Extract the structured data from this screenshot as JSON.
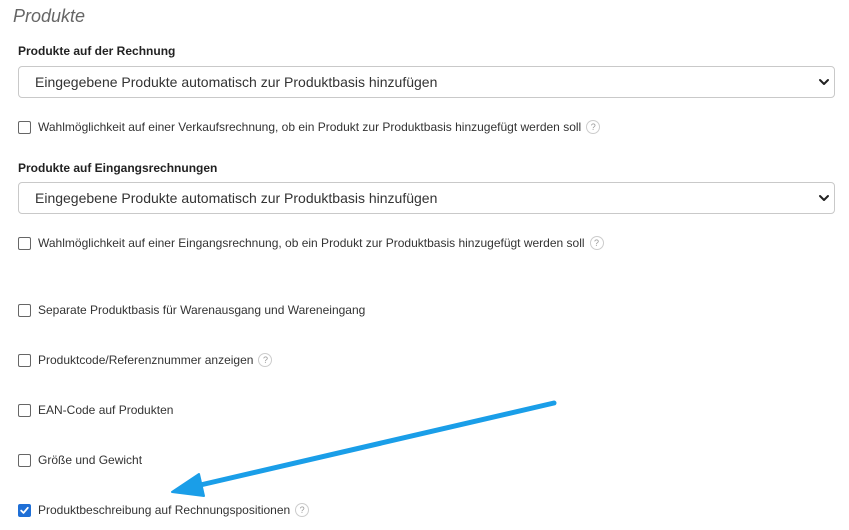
{
  "section": {
    "title": "Produkte"
  },
  "sales": {
    "label": "Produkte auf der Rechnung",
    "select_value": "Eingegebene Produkte automatisch zur Produktbasis hinzufügen",
    "checkbox_label": "Wahlmöglichkeit auf einer Verkaufsrechnung, ob ein Produkt zur Produktbasis hinzugefügt werden soll",
    "checked": false
  },
  "purchase": {
    "label": "Produkte auf Eingangsrechnungen",
    "select_value": "Eingegebene Produkte automatisch zur Produktbasis hinzufügen",
    "checkbox_label": "Wahlmöglichkeit auf einer Eingangsrechnung, ob ein Produkt zur Produktbasis hinzugefügt werden soll",
    "checked": false
  },
  "options": [
    {
      "label": "Separate Produktbasis für Warenausgang und Wareneingang",
      "checked": false,
      "help": false
    },
    {
      "label": "Produktcode/Referenznummer anzeigen",
      "checked": false,
      "help": true
    },
    {
      "label": "EAN-Code auf Produkten",
      "checked": false,
      "help": false
    },
    {
      "label": "Größe und Gewicht",
      "checked": false,
      "help": false
    },
    {
      "label": "Produktbeschreibung auf Rechnungspositionen",
      "checked": true,
      "help": true
    }
  ],
  "help_symbol": "?",
  "icons": {
    "help": "question-mark-circle-icon",
    "select": "chevron-down-icon",
    "check": "checkmark-icon",
    "annotation": "arrow-annotation"
  },
  "colors": {
    "accent": "#1f6fd6",
    "annotation_arrow": "#1a9ee8",
    "section_title": "#666666"
  }
}
